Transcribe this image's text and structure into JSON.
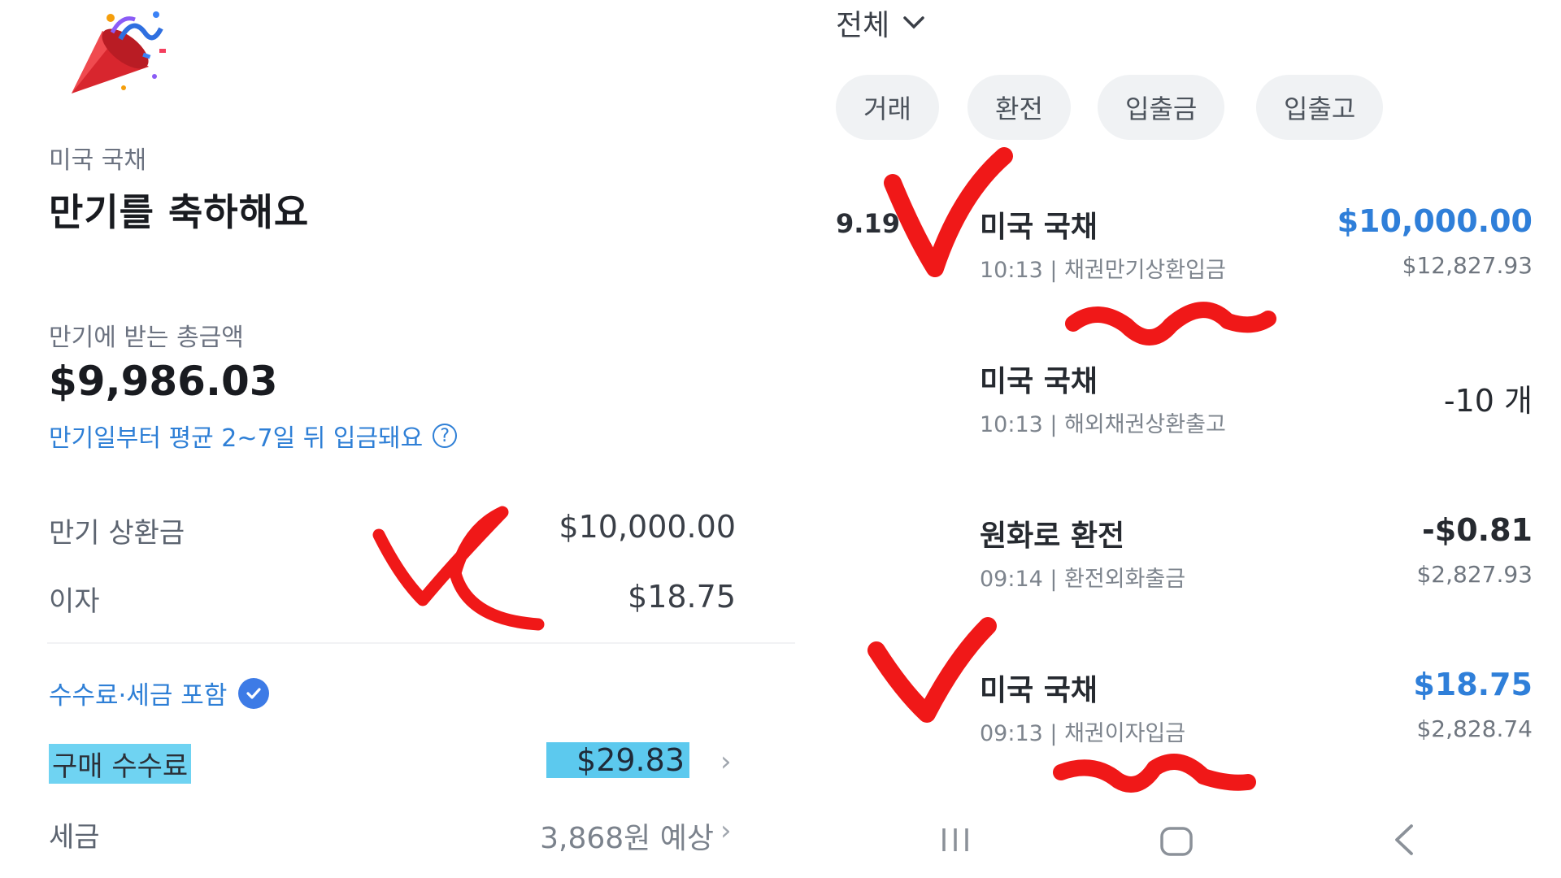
{
  "left": {
    "category": "미국 국채",
    "title": "만기를 축하해요",
    "total_label": "만기에 받는 총금액",
    "total_amount": "$9,986.03",
    "deposit_note": "만기일부터 평균 2~7일 뒤 입금돼요",
    "help_icon": "?",
    "rows": [
      {
        "label": "만기 상환금",
        "value": "$10,000.00"
      },
      {
        "label": "이자",
        "value": "$18.75"
      }
    ],
    "fee_header": "수수료·세금 포함",
    "purchase_fee": {
      "label": "구매 수수료",
      "value": "$29.83"
    },
    "tax": {
      "label": "세금",
      "value": "3,868원 예상"
    }
  },
  "right": {
    "filter": "전체",
    "chips": [
      "거래",
      "환전",
      "입출금",
      "입출고"
    ],
    "date": "9.19",
    "transactions": [
      {
        "name": "미국 국채",
        "sub": "10:13 | 채권만기상환입금",
        "amount": "$10,000.00",
        "balance": "$12,827.93",
        "amount_color": "#2f7fd9"
      },
      {
        "name": "미국 국채",
        "sub": "10:13 | 해외채권상환출고",
        "amount": "-10 개",
        "balance": "",
        "amount_color": "#262a30"
      },
      {
        "name": "원화로 환전",
        "sub": "09:14 | 환전외화출금",
        "amount": "-$0.81",
        "balance": "$2,827.93",
        "amount_color": "#262a30"
      },
      {
        "name": "미국 국채",
        "sub": "09:13 | 채권이자입금",
        "amount": "$18.75",
        "balance": "$2,828.74",
        "amount_color": "#2f7fd9"
      }
    ],
    "navbar": {
      "recent_icon": "recent-apps-icon",
      "home_icon": "home-icon",
      "back_icon": "back-icon"
    }
  },
  "colors": {
    "accent_blue": "#2e7fd6",
    "annotation_red": "#f01818",
    "highlight_cyan": "#5cc9ee"
  }
}
